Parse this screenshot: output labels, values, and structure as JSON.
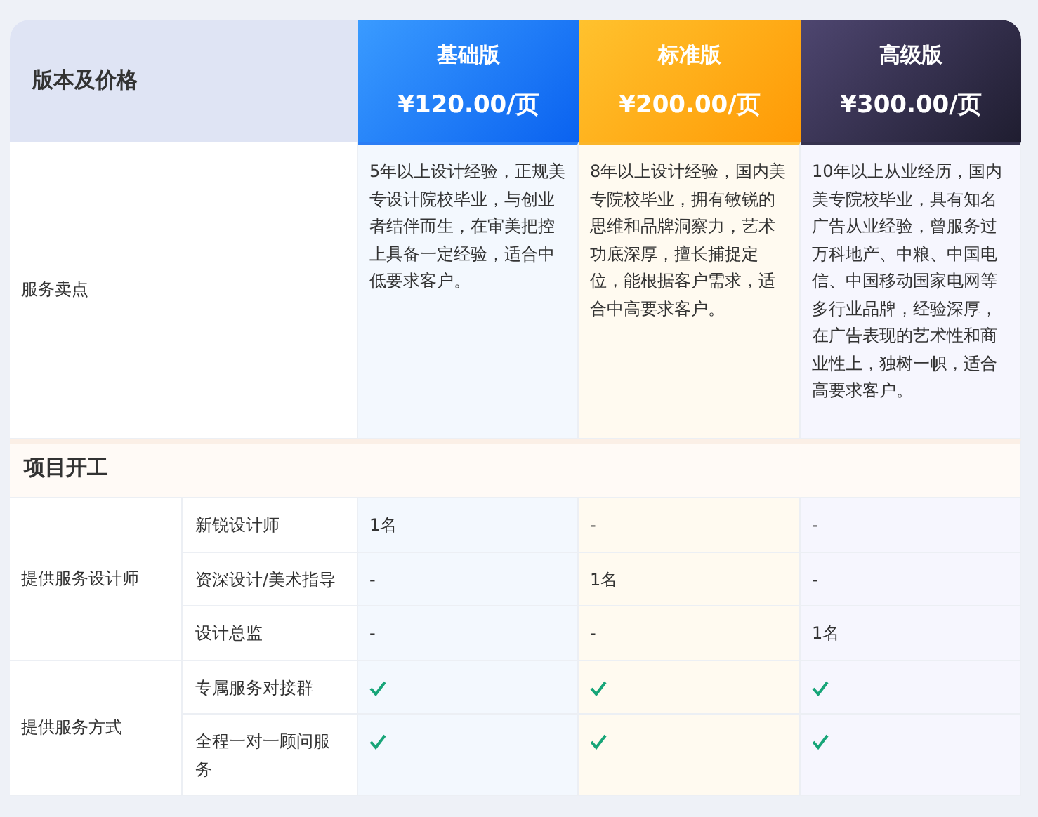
{
  "header": {
    "label": "版本及价格"
  },
  "plans": [
    {
      "name": "基础版",
      "price": "¥120.00/页"
    },
    {
      "name": "标准版",
      "price": "¥200.00/页"
    },
    {
      "name": "高级版",
      "price": "¥300.00/页"
    }
  ],
  "selling_points": {
    "label": "服务卖点",
    "values": [
      "5年以上设计经验，正规美专设计院校毕业，与创业者结伴而生，在审美把控上具备一定经验，适合中低要求客户。",
      "8年以上设计经验，国内美专院校毕业，拥有敏锐的思维和品牌洞察力，艺术功底深厚，擅长捕捉定位，能根据客户需求，适合中高要求客户。",
      "10年以上从业经历，国内美专院校毕业，具有知名广告从业经验，曾服务过万科地产、中粮、中国电信、中国移动国家电网等多行业品牌，经验深厚，在广告表现的艺术性和商业性上，独树一帜，适合高要求客户。"
    ]
  },
  "sections": [
    {
      "title": "项目开工",
      "groups": [
        {
          "label": "提供服务设计师",
          "rows": [
            {
              "label": "新锐设计师",
              "cells": [
                {
                  "kind": "text",
                  "text": "1名"
                },
                {
                  "kind": "text",
                  "text": "-"
                },
                {
                  "kind": "text",
                  "text": "-"
                }
              ]
            },
            {
              "label": "资深设计/美术指导",
              "cells": [
                {
                  "kind": "text",
                  "text": "-"
                },
                {
                  "kind": "text",
                  "text": "1名"
                },
                {
                  "kind": "text",
                  "text": "-"
                }
              ]
            },
            {
              "label": "设计总监",
              "cells": [
                {
                  "kind": "text",
                  "text": "-"
                },
                {
                  "kind": "text",
                  "text": "-"
                },
                {
                  "kind": "text",
                  "text": "1名"
                }
              ]
            }
          ]
        },
        {
          "label": "提供服务方式",
          "rows": [
            {
              "label": "专属服务对接群",
              "cells": [
                {
                  "kind": "check",
                  "checked": true
                },
                {
                  "kind": "check",
                  "checked": true
                },
                {
                  "kind": "check",
                  "checked": true
                }
              ]
            },
            {
              "label": "全程一对一顾问服务",
              "cells": [
                {
                  "kind": "check",
                  "checked": true
                },
                {
                  "kind": "check",
                  "checked": true
                },
                {
                  "kind": "check",
                  "checked": true
                }
              ]
            }
          ]
        }
      ]
    }
  ]
}
